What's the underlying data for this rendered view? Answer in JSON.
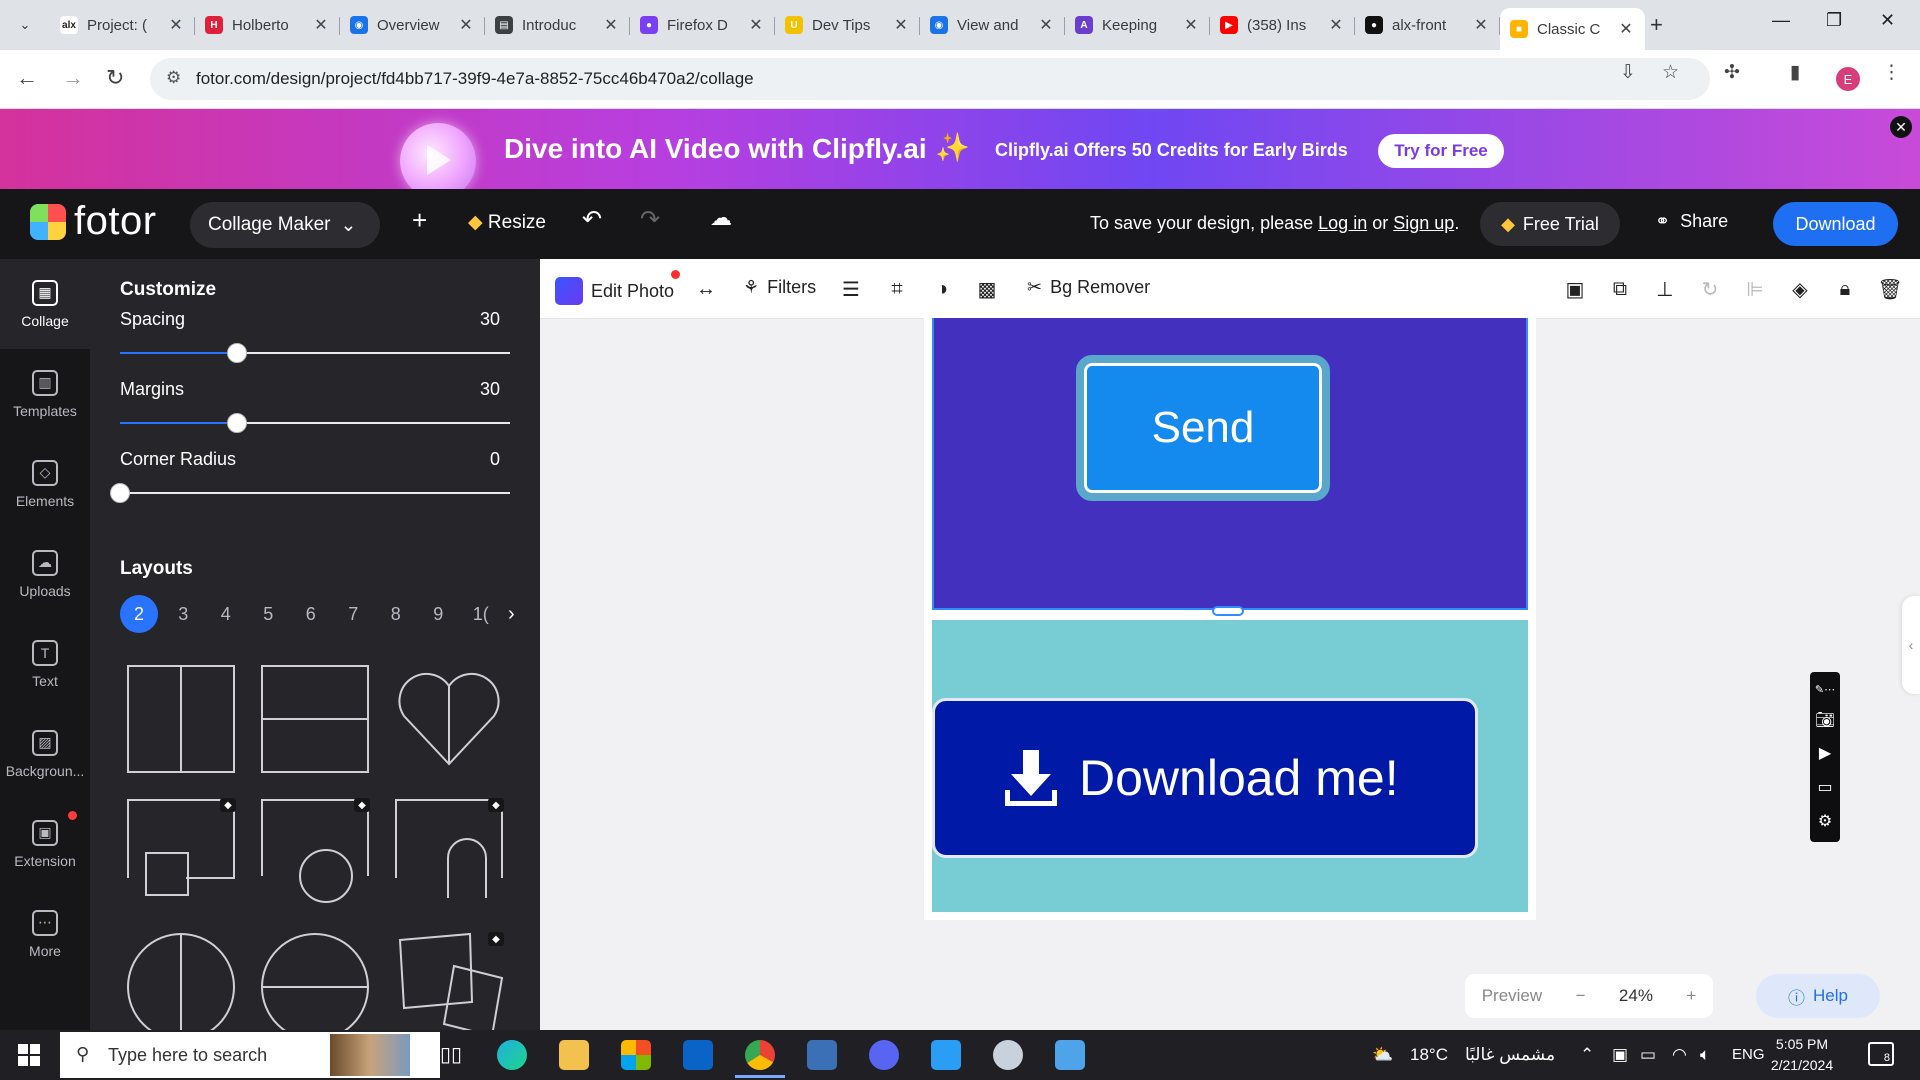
{
  "browser": {
    "tabs": [
      {
        "label": "Project: (",
        "icon": "alx-icon",
        "color": "#ffffff",
        "glyph": "alx"
      },
      {
        "label": "Holberto",
        "icon": "holberton-icon",
        "color": "#e0203a",
        "glyph": "H"
      },
      {
        "label": "Overview",
        "icon": "chrome-icon",
        "color": "#1a73e8",
        "glyph": "◉"
      },
      {
        "label": "Introduc",
        "icon": "book-icon",
        "color": "#3c4043",
        "glyph": "▤"
      },
      {
        "label": "Firefox D",
        "icon": "firefox-icon",
        "color": "#7a3ff2",
        "glyph": "●"
      },
      {
        "label": "Dev Tips",
        "icon": "devtips-icon",
        "color": "#f2c200",
        "glyph": "U"
      },
      {
        "label": "View and",
        "icon": "chrome-icon",
        "color": "#1a73e8",
        "glyph": "◉"
      },
      {
        "label": "Keeping",
        "icon": "keeping-icon",
        "color": "#6a3fd0",
        "glyph": "A"
      },
      {
        "label": "(358) Ins",
        "icon": "youtube-icon",
        "color": "#ff0000",
        "glyph": "▶"
      },
      {
        "label": "alx-front",
        "icon": "github-icon",
        "color": "#111111",
        "glyph": "●"
      },
      {
        "label": "Classic C",
        "icon": "fotor-icon",
        "color": "#ffb400",
        "glyph": "■",
        "active": true
      }
    ],
    "url": "fotor.com/design/project/fd4bb717-39f9-4e7a-8852-75cc46b470a2/collage",
    "profile_initial": "E"
  },
  "promo": {
    "title": "Dive into AI Video with Clipfly.ai",
    "subtitle": "Clipfly.ai Offers 50 Credits for Early Birds",
    "cta": "Try for Free"
  },
  "header": {
    "logo": "fotor",
    "mode": "Collage Maker",
    "resize": "Resize",
    "save_prefix": "To save your design, please",
    "login": "Log in",
    "or": "or",
    "signup": "Sign up",
    "save_suffix": ".",
    "free_trial": "Free Trial",
    "share": "Share",
    "download": "Download"
  },
  "rail": [
    {
      "label": "Collage",
      "icon": "collage-icon",
      "glyph": "▦",
      "active": true
    },
    {
      "label": "Templates",
      "icon": "templates-icon",
      "glyph": "▥"
    },
    {
      "label": "Elements",
      "icon": "elements-icon",
      "glyph": "◇"
    },
    {
      "label": "Uploads",
      "icon": "upload-icon",
      "glyph": "☁"
    },
    {
      "label": "Text",
      "icon": "text-icon",
      "glyph": "T"
    },
    {
      "label": "Backgroun...",
      "icon": "background-icon",
      "glyph": "▨"
    },
    {
      "label": "Extension",
      "icon": "extension-icon",
      "glyph": "▣",
      "dot": true
    },
    {
      "label": "More",
      "icon": "more-icon",
      "glyph": "⋯"
    }
  ],
  "panel": {
    "customize_title": "Customize",
    "sliders": [
      {
        "label": "Spacing",
        "value": "30",
        "fraction": 0.3
      },
      {
        "label": "Margins",
        "value": "30",
        "fraction": 0.3
      },
      {
        "label": "Corner Radius",
        "value": "0",
        "fraction": 0.0
      }
    ],
    "layouts_title": "Layouts",
    "layout_numbers": [
      "2",
      "3",
      "4",
      "5",
      "6",
      "7",
      "8",
      "9",
      "1("
    ],
    "selected_layout": "2"
  },
  "toolbar": {
    "edit_photo": "Edit Photo",
    "filters": "Filters",
    "bg_remover": "Bg Remover"
  },
  "canvas": {
    "top_button_text": "Send",
    "bottom_button_text": "Download me!"
  },
  "zoom": {
    "preview": "Preview",
    "minus": "−",
    "value": "24%",
    "plus": "+"
  },
  "help": "Help",
  "taskbar": {
    "search_placeholder": "Type here to search",
    "weather": "18°C",
    "weather_text": "مشمس غالبًا",
    "language": "ENG",
    "time": "5:05 PM",
    "date": "2/21/2024",
    "notifications": "8"
  }
}
